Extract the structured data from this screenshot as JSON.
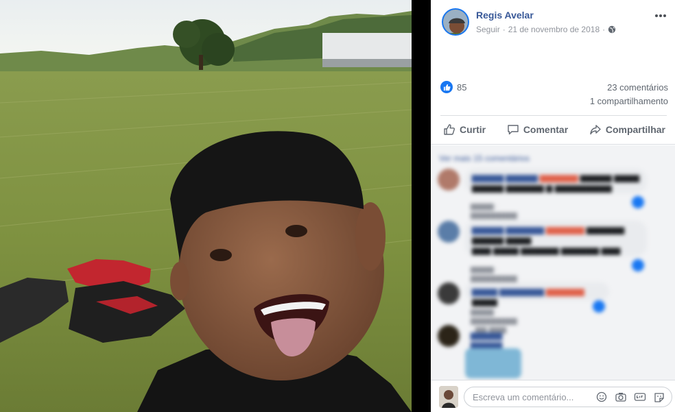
{
  "post": {
    "author": "Regis Avelar",
    "follow_label": "Seguir",
    "separator": "·",
    "date": "21 de novembro de 2018",
    "separator2": "·",
    "more_icon": "more-horizontal-icon"
  },
  "stats": {
    "likes": "85",
    "comments": "23 comentários",
    "shares": "1 compartilhamento"
  },
  "actions": {
    "like": "Curtir",
    "comment": "Comentar",
    "share": "Compartilhar"
  },
  "comments_section": {
    "view_more": "Ver mais 15 comentários"
  },
  "composer": {
    "placeholder": "Escreva um comentário..."
  },
  "colors": {
    "brand": "#1877f2",
    "link": "#385898"
  }
}
